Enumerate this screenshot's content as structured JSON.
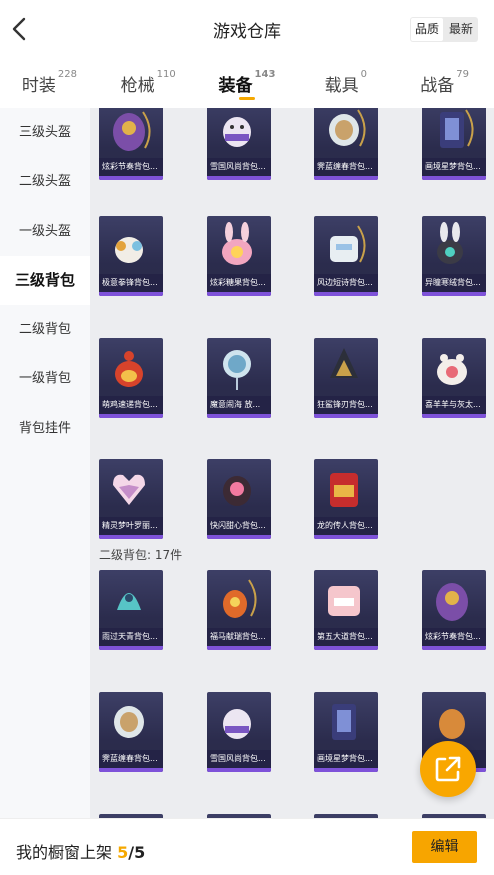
{
  "header": {
    "title": "游戏仓库",
    "sort_options": [
      "品质",
      "最新"
    ],
    "sort_selected": "品质"
  },
  "tabs": [
    {
      "label": "时装",
      "count": "228"
    },
    {
      "label": "枪械",
      "count": "110"
    },
    {
      "label": "装备",
      "count": "143",
      "active": true
    },
    {
      "label": "载具",
      "count": "0"
    },
    {
      "label": "战备",
      "count": "79"
    }
  ],
  "sidebar": {
    "items": [
      "三级头盔",
      "二级头盔",
      "一级头盔",
      "三级背包",
      "二级背包",
      "一级背包",
      "背包挂件"
    ],
    "active": "三级背包"
  },
  "grid": {
    "rows_lv3": [
      [
        "炫彩节奏背包...",
        "雪国风尚背包...",
        "霁蓝缠春背包...",
        "画境星梦背包..."
      ],
      [
        "极意拳锋背包...",
        "炫彩糖果背包...",
        "风边短诗背包...",
        "异瞳寒绒背包..."
      ],
      [
        "萌鸡速递背包...",
        "魔意闹海 放...",
        "狂鲨锋刃背包...",
        "喜羊羊与灰太..."
      ],
      [
        "精灵梦叶罗丽...",
        "快闪甜心背包...",
        "龙的传人背包..."
      ]
    ],
    "section_label": "二级背包: 17件",
    "rows_lv2": [
      [
        "雨过天青背包...",
        "福马献瑞背包...",
        "第五大道背包...",
        "炫彩节奏背包..."
      ],
      [
        "霁蓝缠春背包...",
        "雪国风尚背包...",
        "画境星梦背包...",
        "..."
      ]
    ]
  },
  "bottom_bar": {
    "label": "我的橱窗上架",
    "shown": "5",
    "separator": "/",
    "total": "5",
    "edit_label": "编辑"
  },
  "colors": {
    "accent": "#f7a500",
    "card_bg": "#2b2c4d",
    "card_bar": "#7e52d9"
  }
}
